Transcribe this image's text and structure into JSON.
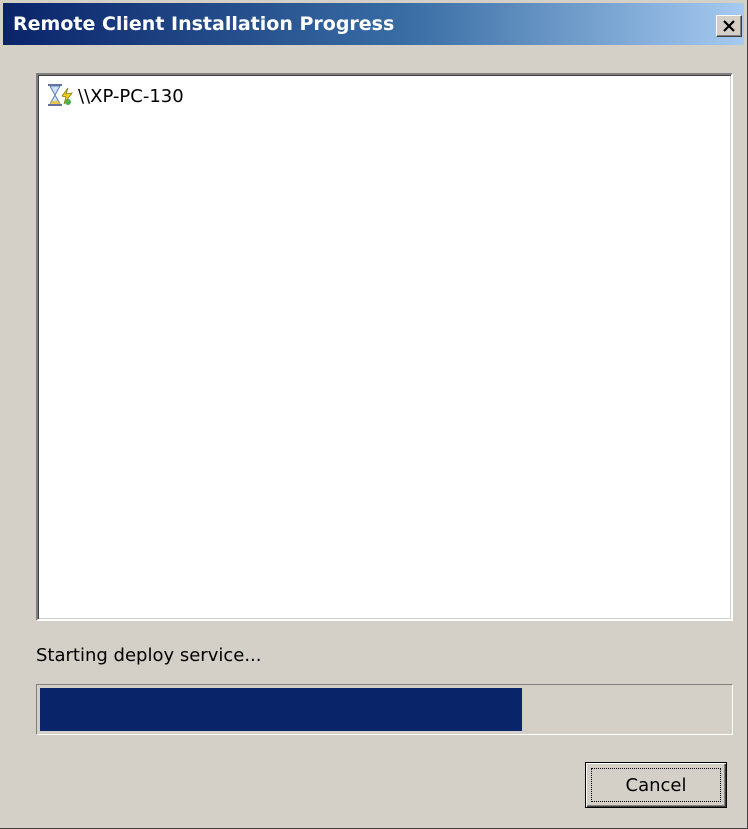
{
  "window": {
    "title": "Remote Client Installation Progress",
    "close_icon": "close-icon"
  },
  "list": {
    "items": [
      {
        "label": "\\\\XP-PC-130",
        "icon": "hourglass-computer-icon"
      }
    ]
  },
  "status": {
    "text": "Starting deploy service..."
  },
  "progress": {
    "percent": 70,
    "color": "#0a246a"
  },
  "buttons": {
    "cancel_label": "Cancel"
  }
}
